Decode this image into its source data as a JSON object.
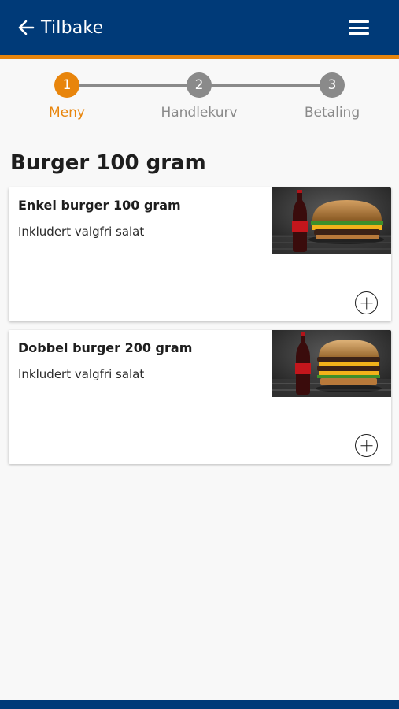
{
  "header": {
    "back_label": "Tilbake",
    "back_icon": "arrow-left-icon",
    "menu_icon": "hamburger-menu-icon",
    "background_color": "#003a78",
    "accent_color": "#e8850c"
  },
  "stepper": {
    "steps": [
      {
        "number": "1",
        "label": "Meny",
        "active": true
      },
      {
        "number": "2",
        "label": "Handlekurv",
        "active": false
      },
      {
        "number": "3",
        "label": "Betaling",
        "active": false
      }
    ],
    "active_color": "#e8850c",
    "inactive_color": "#8a8a8a"
  },
  "main": {
    "title": "Burger 100 gram",
    "items": [
      {
        "name": "Enkel burger 100 gram",
        "description": "Inkludert valgfri salat",
        "image": "single-burger-with-cola-image"
      },
      {
        "name": "Dobbel burger 200 gram",
        "description": "Inkludert valgfri salat",
        "image": "double-burger-with-cola-image"
      }
    ]
  }
}
